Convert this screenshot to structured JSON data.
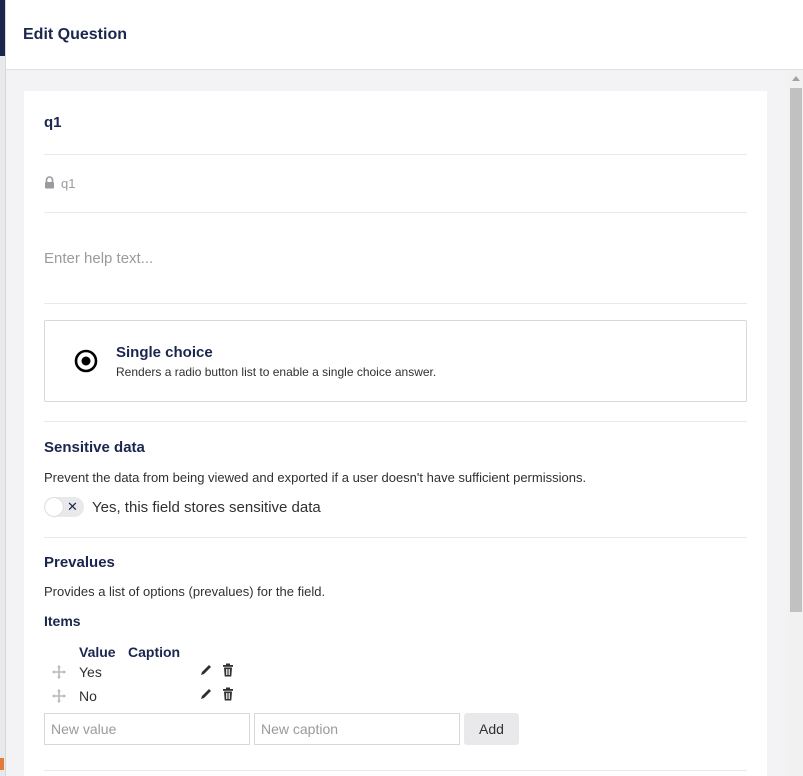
{
  "header": {
    "title": "Edit Question"
  },
  "question": {
    "name": "q1",
    "alias": "q1",
    "help_placeholder": "Enter help text..."
  },
  "field_type": {
    "name": "Single choice",
    "description": "Renders a radio button list to enable a single choice answer.",
    "icon": "radio-button-icon"
  },
  "sensitive": {
    "heading": "Sensitive data",
    "description": "Prevent the data from being viewed and exported if a user doesn't have sufficient permissions.",
    "toggle_label": "Yes, this field stores sensitive data",
    "toggle_on": false
  },
  "prevalues": {
    "heading": "Prevalues",
    "description": "Provides a list of options (prevalues) for the field.",
    "items_label": "Items",
    "columns": [
      "Value",
      "Caption"
    ],
    "items": [
      {
        "value": "Yes",
        "caption": ""
      },
      {
        "value": "No",
        "caption": ""
      }
    ],
    "new_value_placeholder": "New value",
    "new_caption_placeholder": "New caption",
    "add_label": "Add"
  }
}
